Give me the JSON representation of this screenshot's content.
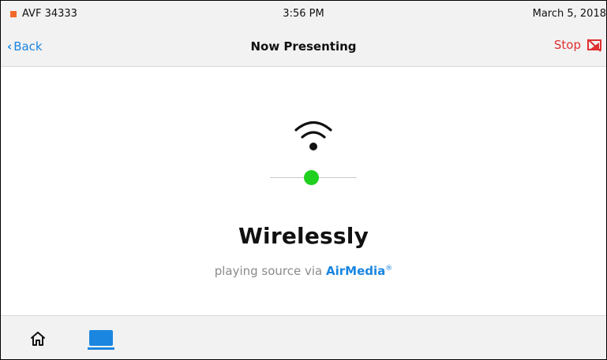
{
  "status_bar": {
    "room_name": "AVF 34333",
    "time": "3:56 PM",
    "date": "March 5, 2018",
    "indicator_color": "#f26a2a"
  },
  "nav": {
    "back_label": "Back",
    "title": "Now Presenting",
    "stop_label": "Stop"
  },
  "presentation": {
    "heading": "Wirelessly",
    "subtext": "playing source via",
    "brand": "AirMedia",
    "brand_mark": "®",
    "status_color": "#1fd01f",
    "icon": "wifi-icon"
  },
  "footer": {
    "items": [
      {
        "icon": "home-icon",
        "active": false
      },
      {
        "icon": "laptop-icon",
        "active": true
      }
    ]
  },
  "colors": {
    "accent": "#1a86e0",
    "stop": "#e03030"
  }
}
